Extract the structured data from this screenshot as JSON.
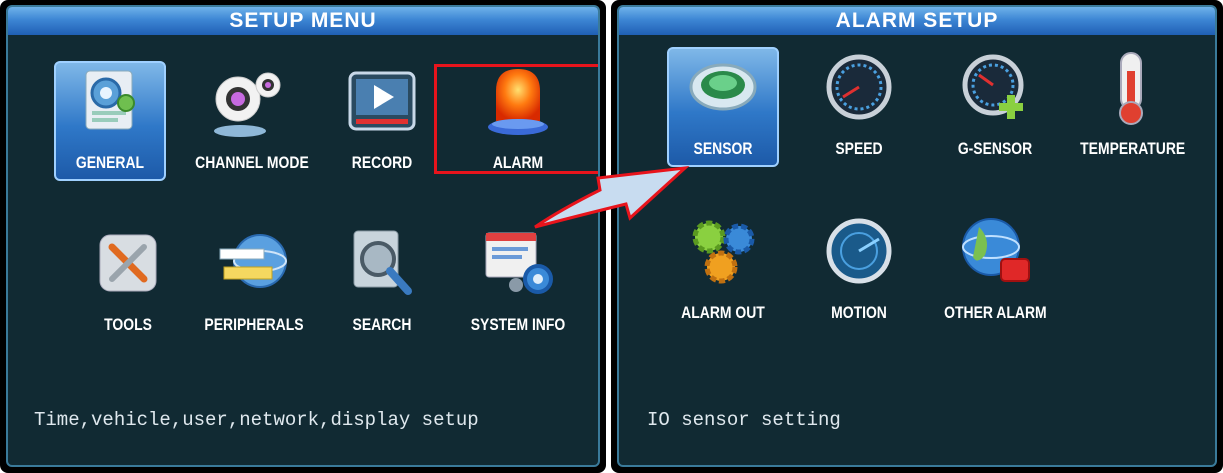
{
  "left": {
    "title": "SETUP MENU",
    "items": [
      {
        "label": "GENERAL",
        "icon": "general-settings-icon",
        "selected": true
      },
      {
        "label": "CHANNEL MODE",
        "icon": "webcam-icon"
      },
      {
        "label": "RECORD",
        "icon": "record-play-icon"
      },
      {
        "label": "ALARM",
        "icon": "alarm-light-icon",
        "highlighted": true
      },
      {
        "label": "TOOLS",
        "icon": "tools-icon"
      },
      {
        "label": "PERIPHERALS",
        "icon": "peripherals-globe-icon"
      },
      {
        "label": "SEARCH",
        "icon": "search-magnifier-icon"
      },
      {
        "label": "SYSTEM INFO",
        "icon": "system-info-icon"
      }
    ],
    "status": "Time,vehicle,user,network,display setup"
  },
  "right": {
    "title": "ALARM SETUP",
    "items": [
      {
        "label": "SENSOR",
        "icon": "sensor-icon",
        "selected": true
      },
      {
        "label": "SPEED",
        "icon": "speedometer-icon"
      },
      {
        "label": "G-SENSOR",
        "icon": "g-sensor-icon"
      },
      {
        "label": "TEMPERATURE",
        "icon": "thermometer-icon"
      },
      {
        "label": "ALARM OUT",
        "icon": "gears-icon"
      },
      {
        "label": "MOTION",
        "icon": "motion-radar-icon"
      },
      {
        "label": "OTHER ALARM",
        "icon": "globe-alarm-icon"
      }
    ],
    "status": "IO sensor setting"
  },
  "colors": {
    "panel_bg": "#112a33",
    "title_bar": "#3d86d4",
    "highlight_box": "#e8141c",
    "selection": "#2f78c8"
  }
}
